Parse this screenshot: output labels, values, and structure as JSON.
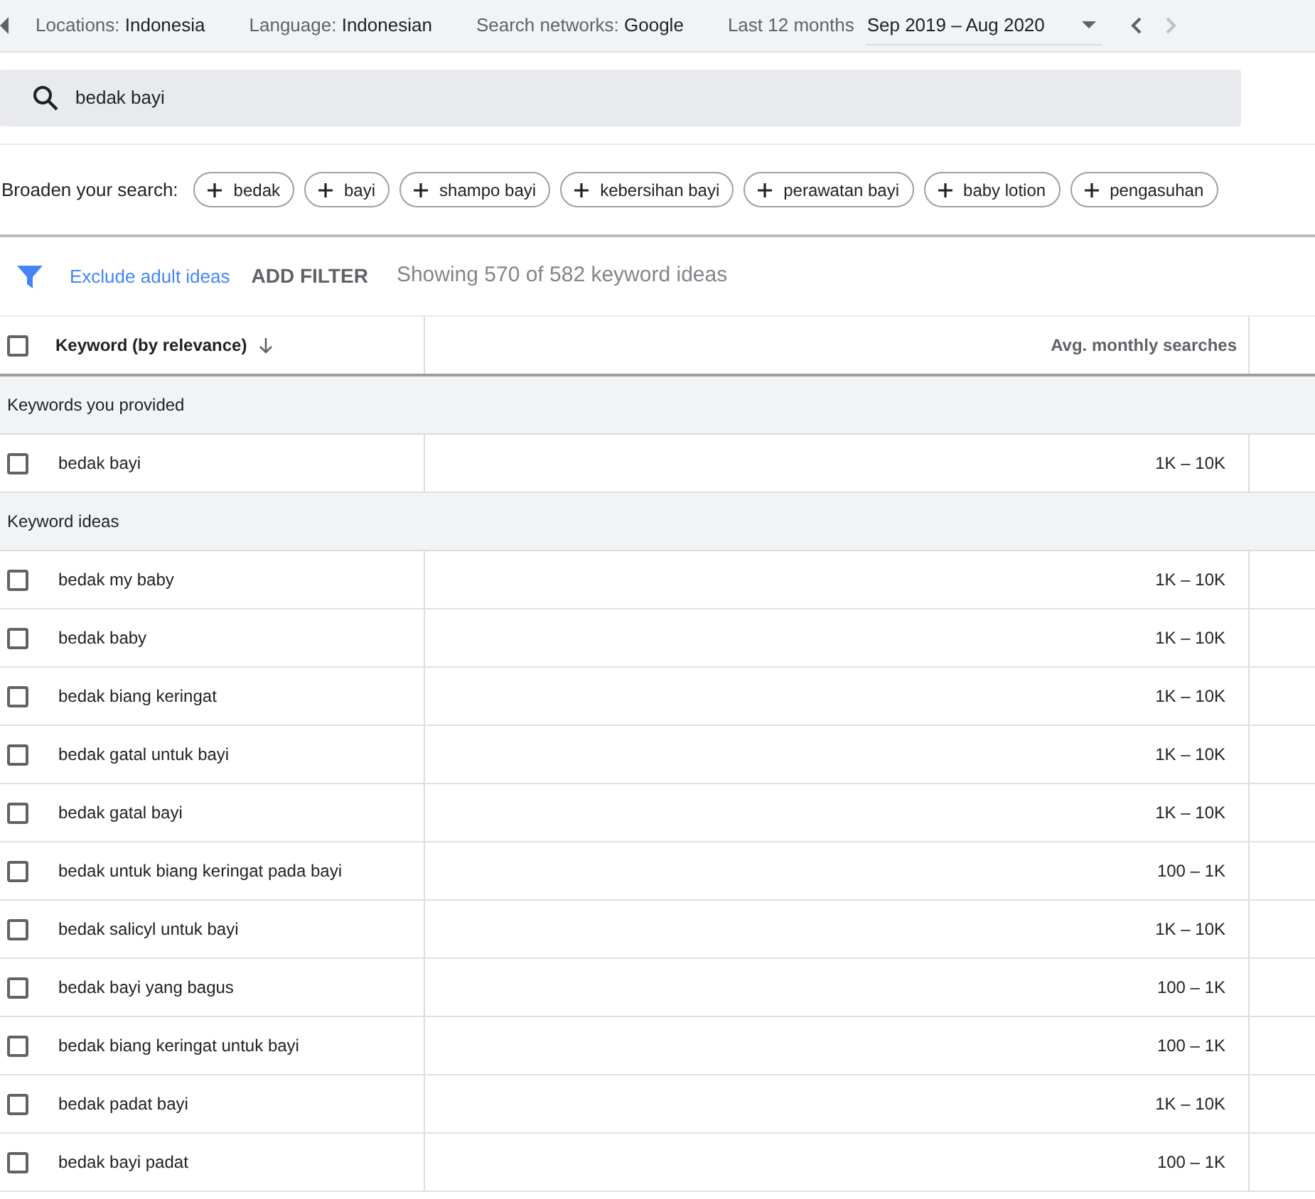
{
  "top_bar": {
    "filters": [
      {
        "label": "Locations:",
        "value": "Indonesia"
      },
      {
        "label": "Language:",
        "value": "Indonesian"
      },
      {
        "label": "Search networks:",
        "value": "Google"
      }
    ],
    "date_range": {
      "label": "Last 12 months",
      "value": "Sep 2019 – Aug 2020"
    }
  },
  "search": {
    "value": "bedak bayi"
  },
  "broaden": {
    "label": "Broaden your search:",
    "chips": [
      "bedak",
      "bayi",
      "shampo bayi",
      "kebersihan bayi",
      "perawatan bayi",
      "baby lotion",
      "pengasuhan"
    ]
  },
  "filter_bar": {
    "exclude": "Exclude adult ideas",
    "add_filter": "ADD FILTER",
    "count": "Showing 570 of 582 keyword ideas"
  },
  "table": {
    "select_all_checked": false,
    "columns": [
      "Keyword (by relevance)",
      "Avg. monthly searches"
    ],
    "groups": [
      {
        "title": "Keywords you provided",
        "rows": [
          {
            "keyword": "bedak bayi",
            "searches": "1K – 10K",
            "checked": false
          }
        ]
      },
      {
        "title": "Keyword ideas",
        "rows": [
          {
            "keyword": "bedak my baby",
            "searches": "1K – 10K",
            "checked": false
          },
          {
            "keyword": "bedak baby",
            "searches": "1K – 10K",
            "checked": false
          },
          {
            "keyword": "bedak biang keringat",
            "searches": "1K – 10K",
            "checked": false
          },
          {
            "keyword": "bedak gatal untuk bayi",
            "searches": "1K – 10K",
            "checked": false
          },
          {
            "keyword": "bedak gatal bayi",
            "searches": "1K – 10K",
            "checked": false
          },
          {
            "keyword": "bedak untuk biang keringat pada bayi",
            "searches": "100 – 1K",
            "checked": false
          },
          {
            "keyword": "bedak salicyl untuk bayi",
            "searches": "1K – 10K",
            "checked": false
          },
          {
            "keyword": "bedak bayi yang bagus",
            "searches": "100 – 1K",
            "checked": false
          },
          {
            "keyword": "bedak biang keringat untuk bayi",
            "searches": "100 – 1K",
            "checked": false
          },
          {
            "keyword": "bedak padat bayi",
            "searches": "1K – 10K",
            "checked": false
          },
          {
            "keyword": "bedak bayi padat",
            "searches": "100 – 1K",
            "checked": false
          }
        ]
      }
    ]
  }
}
